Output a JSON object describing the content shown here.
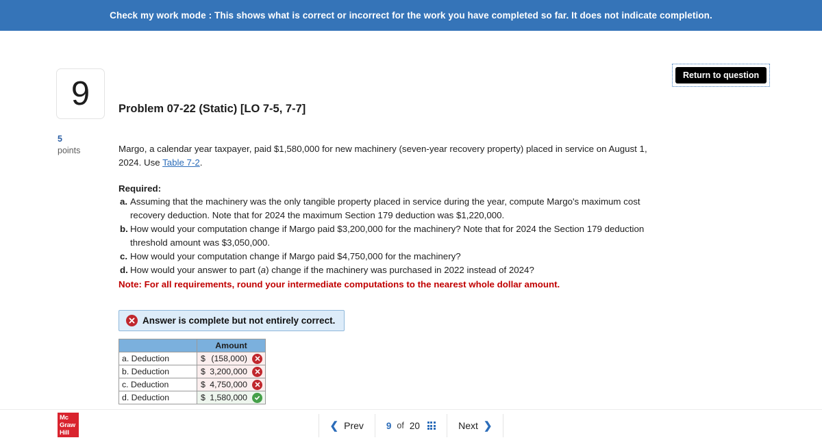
{
  "banner": {
    "text": "Check my work mode : This shows what is correct or incorrect for the work you have completed so far. It does not indicate completion."
  },
  "toolbar": {
    "return_label": "Return to question"
  },
  "question": {
    "number": "9",
    "points_value": "5",
    "points_label": "points",
    "title": "Problem 07-22 (Static) [LO 7-5, 7-7]",
    "intro_part1": "Margo, a calendar year taxpayer, paid $1,580,000 for new machinery (seven-year recovery property) placed in service on August 1, 2024. Use ",
    "intro_link": "Table 7-2",
    "intro_part2": ".",
    "required_heading": "Required:",
    "requirements": [
      {
        "marker": "a.",
        "text": "Assuming that the machinery was the only tangible property placed in service during the year, compute Margo's maximum cost recovery deduction. Note that for 2024 the maximum Section 179 deduction was $1,220,000."
      },
      {
        "marker": "b.",
        "text": "How would your computation change if Margo paid $3,200,000 for the machinery? Note that for 2024 the Section 179 deduction threshold amount was $3,050,000."
      },
      {
        "marker": "c.",
        "text": "How would your computation change if Margo paid $4,750,000 for the machinery?"
      },
      {
        "marker": "d.",
        "text_before": "How would your answer to part (",
        "text_italic": "a",
        "text_after": ") change if the machinery was purchased in 2022 instead of 2024?"
      }
    ],
    "note": "Note: For all requirements, round your intermediate computations to the nearest whole dollar amount."
  },
  "alert": {
    "text": "Answer is complete but not entirely correct.",
    "icon": "circle-x-icon",
    "bg_color": "#ddecf9",
    "border_color": "#8fb8db"
  },
  "answer_table": {
    "headers": [
      "",
      "Amount"
    ],
    "header_bg": "#7bb0dd",
    "rows": [
      {
        "label": "a. Deduction",
        "currency": "$",
        "amount": "(158,000)",
        "status": "incorrect"
      },
      {
        "label": "b. Deduction",
        "currency": "$",
        "amount": "3,200,000",
        "status": "incorrect"
      },
      {
        "label": "c. Deduction",
        "currency": "$",
        "amount": "4,750,000",
        "status": "incorrect"
      },
      {
        "label": "d. Deduction",
        "currency": "$",
        "amount": "1,580,000",
        "status": "correct"
      }
    ]
  },
  "footer": {
    "logo_line1": "Mc",
    "logo_line2": "Graw",
    "logo_line3": "Hill",
    "prev_label": "Prev",
    "next_label": "Next",
    "page_current": "9",
    "page_of": "of",
    "page_total": "20"
  },
  "colors": {
    "banner_blue": "#3574b8",
    "link_blue": "#2b6cb9",
    "note_red": "#c00000",
    "incorrect_red": "#c0272d",
    "correct_green": "#45a049",
    "logo_red": "#d9232e"
  }
}
